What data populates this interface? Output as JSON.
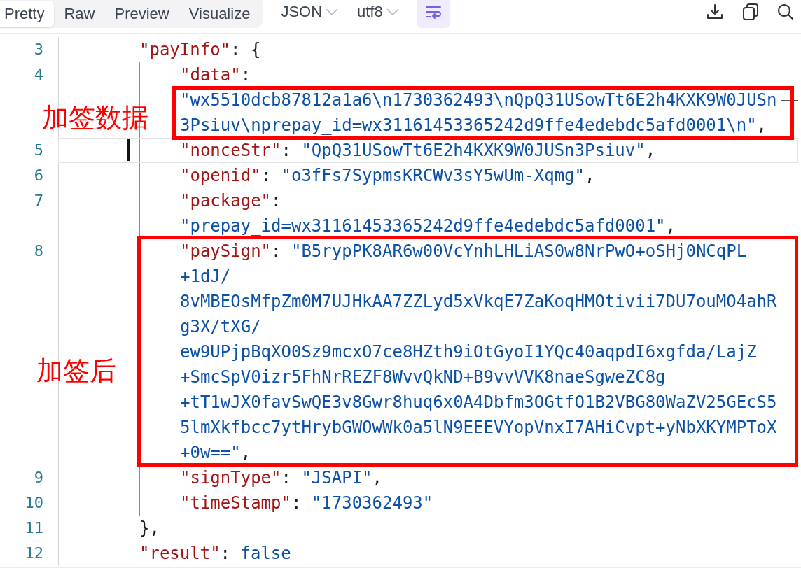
{
  "toolbar": {
    "tabs": [
      {
        "label": "Pretty",
        "selected": true
      },
      {
        "label": "Raw",
        "selected": false
      },
      {
        "label": "Preview",
        "selected": false
      },
      {
        "label": "Visualize",
        "selected": false
      }
    ],
    "dropdowns": [
      {
        "label": "JSON"
      },
      {
        "label": "utf8"
      }
    ],
    "wrap_toggle": {
      "on": true
    }
  },
  "editor": {
    "lines": [
      {
        "number": "3",
        "current": false,
        "kind": "object",
        "key": "\"payInfo\"",
        "sep": ": {",
        "children": [
          {
            "number": "4",
            "current": false,
            "key": "\"data\"",
            "sep": ":",
            "kind": "string",
            "value_on_new_row": true,
            "value_rows": [
              "\"wx5510dcb87812a1a6\\n1730362493\\nQpQ31USowTt6E2h4KXK9W0JUSn",
              "3Psiuv\\nprepay_id=wx31161453365242d9ffe4edebdc5afd0001\\n\""
            ],
            "trail": ","
          },
          {
            "number": "5",
            "current": true,
            "key": "\"nonceStr\"",
            "sep": ": ",
            "kind": "string",
            "value_on_new_row": false,
            "value_rows": [
              "\"QpQ31USowTt6E2h4KXK9W0JUSn3Psiuv\""
            ],
            "trail": ","
          },
          {
            "number": "6",
            "current": false,
            "key": "\"openid\"",
            "sep": ": ",
            "kind": "string",
            "value_on_new_row": false,
            "value_rows": [
              "\"o3fFs7SypmsKRCWv3sY5wUm-Xqmg\""
            ],
            "trail": ","
          },
          {
            "number": "7",
            "current": false,
            "key": "\"package\"",
            "sep": ":",
            "kind": "string",
            "value_on_new_row": true,
            "value_rows": [
              "\"prepay_id=wx31161453365242d9ffe4edebdc5afd0001\""
            ],
            "trail": ","
          },
          {
            "number": "8",
            "current": false,
            "key": "\"paySign\"",
            "sep": ": ",
            "kind": "string",
            "value_on_new_row": false,
            "value_rows": [
              "\"B5rypPK8AR6w00VcYnhLHLiAS0w8NrPwO+oSHj0NCqPL",
              "+1dJ/",
              "8vMBEOsMfpZm0M7UJHkAA7ZZLyd5xVkqE7ZaKoqHMOtivii7DU7ouMO4ahR",
              "g3X/tXG/",
              "ew9UPjpBqXO0Sz9mcxO7ce8HZth9iOtGyoI1YQc40aqpdI6xgfda/LajZ",
              "+SmcSpV0izr5FhNrREZF8WvvQkND+B9vvVVK8naeSgweZC8g",
              "+tT1wJX0favSwQE3v8Gwr8huq6x0A4Dbfm3OGtfO1B2VBG80WaZV25GEcS5",
              "5lmXkfbcc7ytHrybGWOwWk0a5lN9EEEVYopVnxI7AHiCvpt+yNbXKYMPToX",
              "+0w==\""
            ],
            "trail": ","
          },
          {
            "number": "9",
            "current": false,
            "key": "\"signType\"",
            "sep": ": ",
            "kind": "string",
            "value_on_new_row": false,
            "value_rows": [
              "\"JSAPI\""
            ],
            "trail": ","
          },
          {
            "number": "10",
            "current": false,
            "key": "\"timeStamp\"",
            "sep": ": ",
            "kind": "string",
            "value_on_new_row": false,
            "value_rows": [
              "\"1730362493\""
            ]
          }
        ]
      },
      {
        "number": "11",
        "current": false,
        "kind": "close",
        "sep": "},"
      },
      {
        "number": "12",
        "current": false,
        "key": "\"result\"",
        "sep": ": ",
        "kind": "keyword",
        "value_on_new_row": false,
        "value_rows": [
          "false"
        ]
      }
    ]
  },
  "annotations": [
    {
      "label": "加签数据"
    },
    {
      "label": "加签后"
    }
  ]
}
